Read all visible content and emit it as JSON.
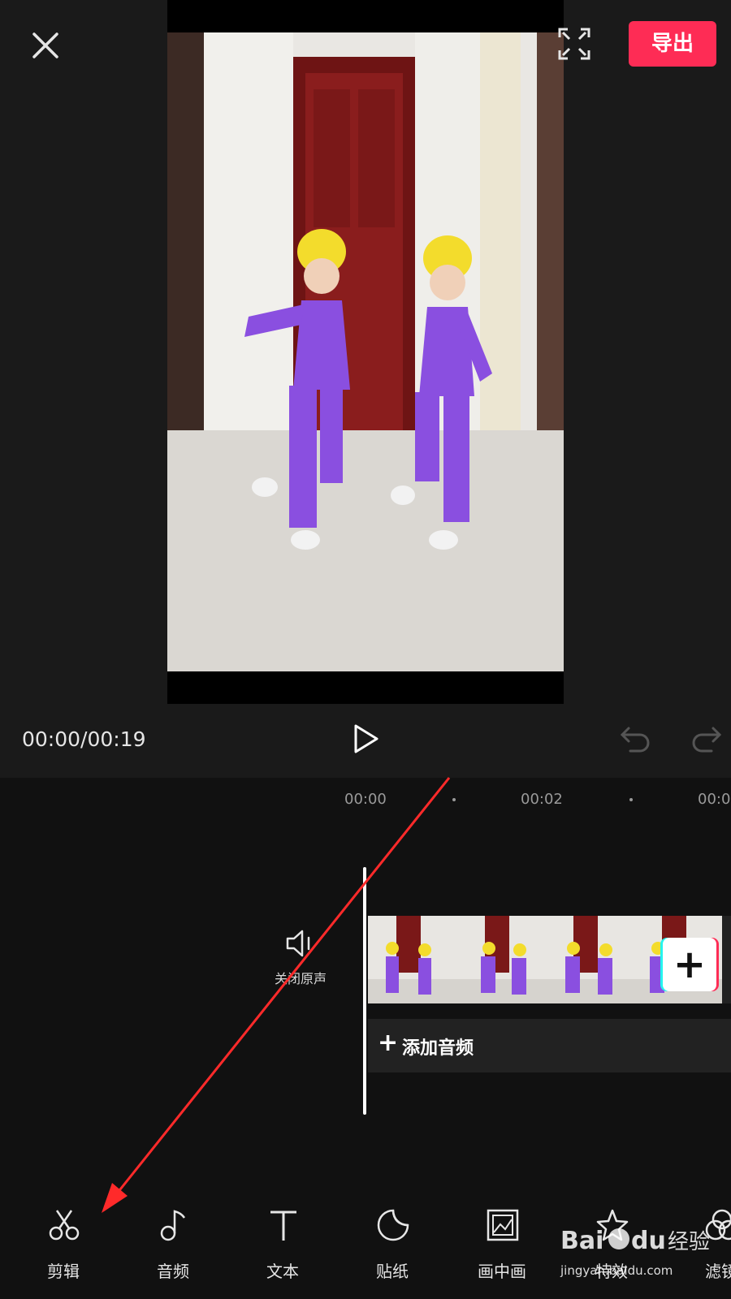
{
  "header": {
    "export_label": "导出"
  },
  "playback": {
    "time": "00:00/00:19"
  },
  "timeline": {
    "ruler": [
      "00:00",
      "00:02",
      "00:0"
    ],
    "mute_label": "关闭原声",
    "add_audio_label": "添加音频"
  },
  "toolbar": {
    "items": [
      {
        "label": "剪辑",
        "icon": "scissors-icon"
      },
      {
        "label": "音频",
        "icon": "music-note-icon"
      },
      {
        "label": "文本",
        "icon": "text-icon"
      },
      {
        "label": "贴纸",
        "icon": "sticker-icon"
      },
      {
        "label": "画中画",
        "icon": "picture-in-picture-icon"
      },
      {
        "label": "特效",
        "icon": "effects-icon"
      },
      {
        "label": "滤镜",
        "icon": "filter-icon"
      }
    ]
  },
  "watermark": {
    "brand": "Baidu经验",
    "site": "jingyan.baidu.com"
  },
  "colors": {
    "accent": "#fe2c55",
    "annotation_arrow": "#ff2a2a"
  }
}
